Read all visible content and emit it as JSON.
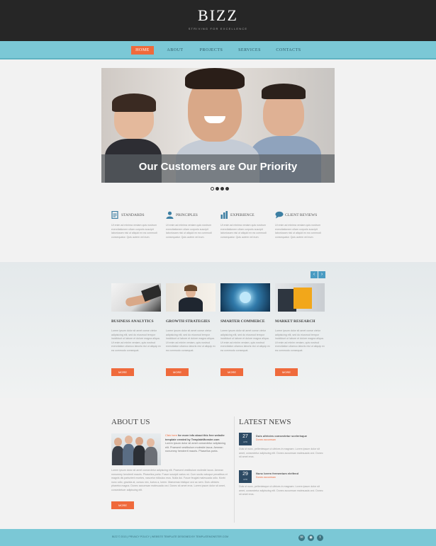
{
  "site": {
    "logo": "BIZZ",
    "tagline": "STRIVING FOR EXCELLENCE"
  },
  "nav": [
    {
      "label": "HOME",
      "active": true
    },
    {
      "label": "ABOUT",
      "active": false
    },
    {
      "label": "PROJECTS",
      "active": false
    },
    {
      "label": "SERVICES",
      "active": false
    },
    {
      "label": "CONTACTS",
      "active": false
    }
  ],
  "hero": {
    "caption": "Our Customers are Our Priority",
    "slides": 4,
    "active_slide": 1
  },
  "features": [
    {
      "icon": "document-icon",
      "title": "STANDARDS",
      "text": "Ut enim ad minima veniam quis nostrum exercitationem ullam corporis suscipit laboriosam nisi ut aliquid ex ea commodi consequatur. Quis autem vel eum."
    },
    {
      "icon": "user-icon",
      "title": "PRINCIPLES",
      "text": "Ut enim ad minima veniam quis nostrum exercitationem ullam corporis suscipit laboriosam nisi ut aliquid ex ea commodi consequatur. Quis autem vel eum."
    },
    {
      "icon": "bar-chart-icon",
      "title": "EXPERIENCE",
      "text": "Ut enim ad minima veniam quis nostrum exercitationem ullam corporis suscipit laboriosam nisi ut aliquid ex ea commodi consequatur. Quis autem vel eum."
    },
    {
      "icon": "chat-bubble-icon",
      "title": "CLIENT REVIEWS",
      "text": "Ut enim ad minima veniam quis nostrum exercitationem ullam corporis suscipit laboriosam nisi ut aliquid ex ea commodi consequatur. Quis autem vel eum."
    }
  ],
  "carousel": {
    "prev_icon": "chevron-left-icon",
    "next_icon": "chevron-right-icon",
    "prev_glyph": "‹",
    "next_glyph": "›"
  },
  "services": [
    {
      "title": "BUSINESS ANALYTICS",
      "text": "Lorem ipsum dolor sit amet conse ctetur adipisicing elit, sed do eiusmod tempor incididunt ut labore et dolore magna aliqua. Ut enim ad minim veniam, quis nostrud exercitation ullamco laboris nisi ut aliquip ex ea commodo consequat.",
      "button": "MORE"
    },
    {
      "title": "GROWTH STRATEGIES",
      "text": "Lorem ipsum dolor sit amet conse ctetur adipisicing elit, sed do eiusmod tempor incididunt ut labore et dolore magna aliqua. Ut enim ad minim veniam, quis nostrud exercitation ullamco laboris nisi ut aliquip ex ea commodo consequat.",
      "button": "MORE"
    },
    {
      "title": "SMARTER COMMERCE",
      "text": "Lorem ipsum dolor sit amet conse ctetur adipisicing elit, sed do eiusmod tempor incididunt ut labore et dolore magna aliqua. Ut enim ad minim veniam, quis nostrud exercitation ullamco laboris nisi ut aliquip ex ea commodo consequat.",
      "button": "MORE"
    },
    {
      "title": "MARKET RESEARCH",
      "text": "Lorem ipsum dolor sit amet conse ctetur adipisicing elit, sed do eiusmod tempor incididunt ut labore et dolore magna aliqua. Ut enim ad minim veniam, quis nostrud exercitation ullamco laboris nisi ut aliquip ex ea commodo consequat.",
      "button": "MORE"
    }
  ],
  "about": {
    "title": "ABOUT US",
    "lead_highlight": "Click here",
    "lead_bold": "for more info about this free website template created by TemplateMonster.com",
    "lead_rest": "Lorem ipsum dolor sit amet consectetur adipisicing elit. Praesent vestibulum molestie lacus. Aenean nonummy hendrerit mauris. Phasellus porta.",
    "text": "Lorem ipsum dolor sit amet consectetur adipiscing elit. Praesent vestibulum molestie lacus. Aenean nonummy hendrerit mauris. Phasellus porta. Fusce suscipit varius mi. Cum sociis natoque penatibus et magnis dis parturient montes, nascetur ridiculus mus. Nulla dui. Fusce feugiat malesuada odio. Morbi nunc odio, gravida at, cursus nec, luctus a, lorem. Maecenas tristique orci ac sem. Duis ultricies pharetra magna. Donec accumsan malesuada orci. Donec sit amet eros. Lorem ipsum dolor sit amet, consectetuer adipiscing elit.",
    "button": "MORE"
  },
  "news": {
    "title": "LATEST NEWS",
    "items": [
      {
        "day": "27",
        "month": "APR",
        "headline": "Duis ultricies consectetur scelerisque",
        "sub": "Donec accumsan",
        "text": "Duis ut nunc, pellentesque ut ultrices in magnam. Lorem ipsum dolor sit amet, consectetur adipiscing elit. Donec accumsan malesuada orci. Donec sit amet eros."
      },
      {
        "day": "29",
        "month": "APR",
        "headline": "Nunc lorem fermentum eleifend",
        "sub": "Donec accumsan",
        "text": "Duis ut nunc, pellentesque ut ultrices in magnam. Lorem ipsum dolor sit amet, consectetur adipiscing elit. Donec accumsan malesuada orci. Donec sit amet eros."
      }
    ]
  },
  "footer": {
    "copyright": "BIZZ © 2013 | PRIVACY POLICY | WEBSITE TEMPLATE DESIGNED BY TEMPLATEMONSTER.COM",
    "social": [
      {
        "icon": "mail-icon",
        "glyph": "✉"
      },
      {
        "icon": "rss-icon",
        "glyph": "◉"
      },
      {
        "icon": "twitter-icon",
        "glyph": "t"
      }
    ]
  },
  "colors": {
    "accent": "#ef6a3c",
    "nav": "#7bc8d6",
    "header": "#262626",
    "icon_blue": "#3d7fa3",
    "date_bg": "#2d4a64"
  }
}
